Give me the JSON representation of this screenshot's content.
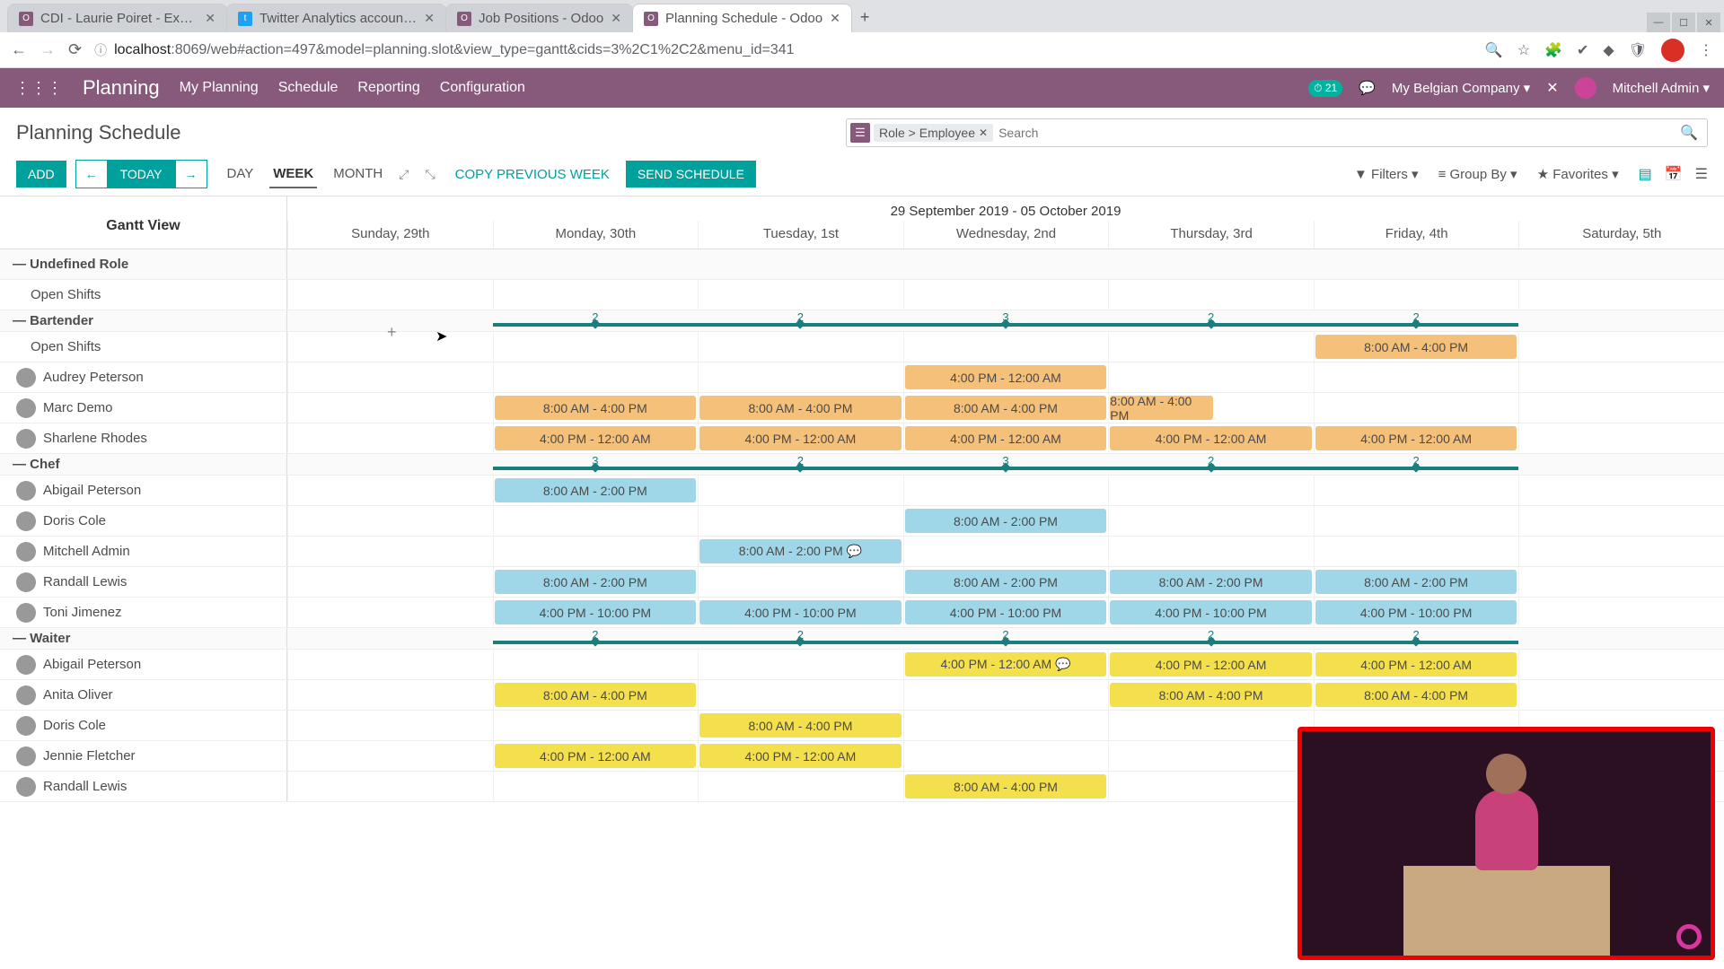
{
  "browser": {
    "tabs": [
      {
        "title": "CDI - Laurie Poiret - Experien",
        "fav": "O",
        "favbg": "#875A7B"
      },
      {
        "title": "Twitter Analytics account ov",
        "fav": "t",
        "favbg": "#1DA1F2"
      },
      {
        "title": "Job Positions - Odoo",
        "fav": "O",
        "favbg": "#875A7B"
      },
      {
        "title": "Planning Schedule - Odoo",
        "fav": "O",
        "favbg": "#875A7B"
      }
    ],
    "url_host": "localhost",
    "url_rest": ":8069/web#action=497&model=planning.slot&view_type=gantt&cids=3%2C1%2C2&menu_id=341"
  },
  "app": {
    "title": "Planning",
    "menu": [
      "My Planning",
      "Schedule",
      "Reporting",
      "Configuration"
    ],
    "badge": "21",
    "company": "My Belgian Company",
    "user": "Mitchell Admin"
  },
  "cp": {
    "page_title": "Planning Schedule",
    "facet": "Role > Employee",
    "search_ph": "Search",
    "add": "ADD",
    "today": "TODAY",
    "scales": [
      "DAY",
      "WEEK",
      "MONTH"
    ],
    "active_scale": "WEEK",
    "copy": "COPY PREVIOUS WEEK",
    "send": "SEND SCHEDULE",
    "filters": "Filters",
    "groupby": "Group By",
    "favorites": "Favorites"
  },
  "gantt": {
    "view_label": "Gantt View",
    "range": "29 September 2019 - 05 October 2019",
    "days": [
      "Sunday, 29th",
      "Monday, 30th",
      "Tuesday, 1st",
      "Wednesday, 2nd",
      "Thursday, 3rd",
      "Friday, 4th",
      "Saturday, 5th"
    ],
    "groups": [
      {
        "name": "Undefined Role",
        "totals": [],
        "rows": [
          {
            "name": "Open Shifts",
            "avatar": false,
            "slots": []
          }
        ]
      },
      {
        "name": "Bartender",
        "totals": [
          null,
          2,
          2,
          3,
          2,
          2,
          null
        ],
        "rows": [
          {
            "name": "Open Shifts",
            "avatar": false,
            "slots": [
              {
                "d": 5,
                "t": "8:00 AM - 4:00 PM",
                "c": "c-orange"
              }
            ]
          },
          {
            "name": "Audrey Peterson",
            "avatar": true,
            "slots": [
              {
                "d": 3,
                "t": "4:00 PM - 12:00 AM",
                "c": "c-orange"
              }
            ]
          },
          {
            "name": "Marc Demo",
            "avatar": true,
            "slots": [
              {
                "d": 1,
                "t": "8:00 AM - 4:00 PM",
                "c": "c-orange"
              },
              {
                "d": 2,
                "t": "8:00 AM - 4:00 PM",
                "c": "c-orange"
              },
              {
                "d": 3,
                "t": "8:00 AM - 4:00 PM",
                "c": "c-orange"
              },
              {
                "d": 4,
                "t": "8:00 AM - 4:00 PM",
                "c": "c-orange",
                "half": true
              }
            ]
          },
          {
            "name": "Sharlene Rhodes",
            "avatar": true,
            "slots": [
              {
                "d": 1,
                "t": "4:00 PM - 12:00 AM",
                "c": "c-orange"
              },
              {
                "d": 2,
                "t": "4:00 PM - 12:00 AM",
                "c": "c-orange"
              },
              {
                "d": 3,
                "t": "4:00 PM - 12:00 AM",
                "c": "c-orange"
              },
              {
                "d": 4,
                "t": "4:00 PM - 12:00 AM",
                "c": "c-orange"
              },
              {
                "d": 5,
                "t": "4:00 PM - 12:00 AM",
                "c": "c-orange"
              }
            ]
          }
        ]
      },
      {
        "name": "Chef",
        "totals": [
          null,
          3,
          2,
          3,
          2,
          2,
          null
        ],
        "rows": [
          {
            "name": "Abigail Peterson",
            "avatar": true,
            "slots": [
              {
                "d": 1,
                "t": "8:00 AM - 2:00 PM",
                "c": "c-blue"
              }
            ]
          },
          {
            "name": "Doris Cole",
            "avatar": true,
            "slots": [
              {
                "d": 3,
                "t": "8:00 AM - 2:00 PM",
                "c": "c-blue"
              }
            ]
          },
          {
            "name": "Mitchell Admin",
            "avatar": true,
            "slots": [
              {
                "d": 2,
                "t": "8:00 AM - 2:00 PM 💬",
                "c": "c-blue",
                "wide": true
              }
            ]
          },
          {
            "name": "Randall Lewis",
            "avatar": true,
            "slots": [
              {
                "d": 1,
                "t": "8:00 AM - 2:00 PM",
                "c": "c-blue",
                "wide": true
              },
              {
                "d": 3,
                "t": "8:00 AM - 2:00 PM",
                "c": "c-blue"
              },
              {
                "d": 4,
                "t": "8:00 AM - 2:00 PM",
                "c": "c-blue"
              },
              {
                "d": 5,
                "t": "8:00 AM - 2:00 PM",
                "c": "c-blue"
              }
            ]
          },
          {
            "name": "Toni Jimenez",
            "avatar": true,
            "slots": [
              {
                "d": 1,
                "t": "4:00 PM - 10:00 PM",
                "c": "c-blue"
              },
              {
                "d": 2,
                "t": "4:00 PM - 10:00 PM",
                "c": "c-blue"
              },
              {
                "d": 3,
                "t": "4:00 PM - 10:00 PM",
                "c": "c-blue"
              },
              {
                "d": 4,
                "t": "4:00 PM - 10:00 PM",
                "c": "c-blue"
              },
              {
                "d": 5,
                "t": "4:00 PM - 10:00 PM",
                "c": "c-blue"
              }
            ]
          }
        ]
      },
      {
        "name": "Waiter",
        "totals": [
          null,
          2,
          2,
          2,
          2,
          2,
          null
        ],
        "rows": [
          {
            "name": "Abigail Peterson",
            "avatar": true,
            "slots": [
              {
                "d": 3,
                "t": "4:00 PM - 12:00 AM 💬",
                "c": "c-yellow"
              },
              {
                "d": 4,
                "t": "4:00 PM - 12:00 AM",
                "c": "c-yellow"
              },
              {
                "d": 5,
                "t": "4:00 PM - 12:00 AM",
                "c": "c-yellow"
              }
            ]
          },
          {
            "name": "Anita Oliver",
            "avatar": true,
            "slots": [
              {
                "d": 1,
                "t": "8:00 AM - 4:00 PM",
                "c": "c-yellow"
              },
              {
                "d": 4,
                "t": "8:00 AM - 4:00 PM",
                "c": "c-yellow"
              },
              {
                "d": 5,
                "t": "8:00 AM - 4:00 PM",
                "c": "c-yellow"
              }
            ]
          },
          {
            "name": "Doris Cole",
            "avatar": true,
            "slots": [
              {
                "d": 2,
                "t": "8:00 AM - 4:00 PM",
                "c": "c-yellow"
              }
            ]
          },
          {
            "name": "Jennie Fletcher",
            "avatar": true,
            "slots": [
              {
                "d": 1,
                "t": "4:00 PM - 12:00 AM",
                "c": "c-yellow"
              },
              {
                "d": 2,
                "t": "4:00 PM - 12:00 AM",
                "c": "c-yellow"
              }
            ]
          },
          {
            "name": "Randall Lewis",
            "avatar": true,
            "slots": [
              {
                "d": 3,
                "t": "8:00 AM - 4:00 PM",
                "c": "c-yellow"
              }
            ]
          }
        ]
      }
    ]
  }
}
